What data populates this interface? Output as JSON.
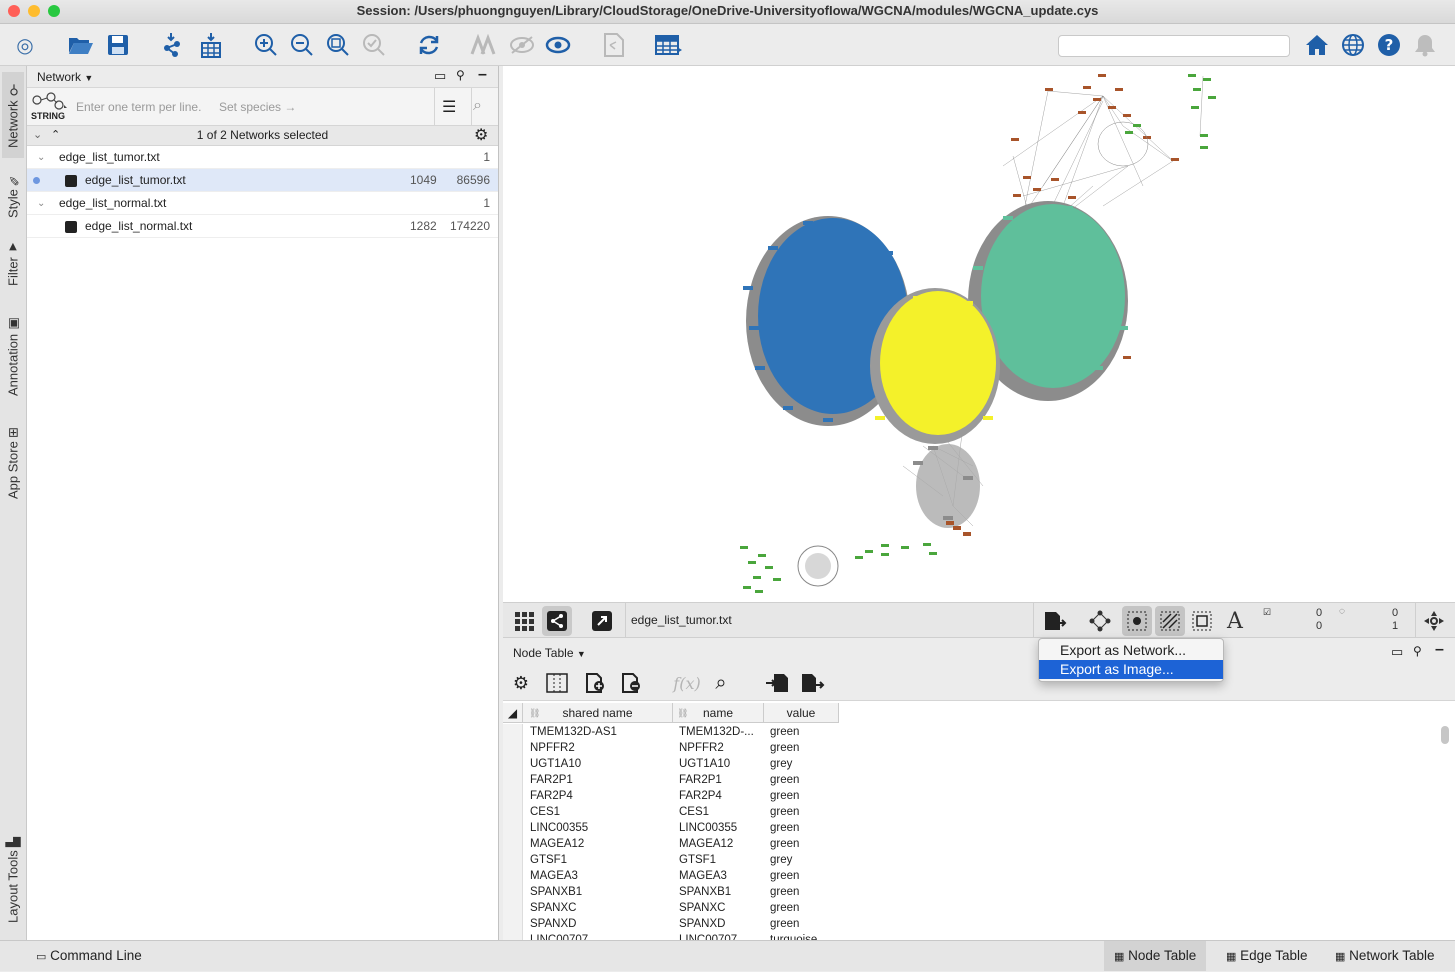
{
  "window": {
    "title": "Session: /Users/phuongnguyen/Library/CloudStorage/OneDrive-UniversityofIowa/WGCNA/modules/WGCNA_update.cys"
  },
  "toolbar": {
    "search_placeholder": ""
  },
  "side_tabs": [
    "Network",
    "Style",
    "Filter",
    "Annotation",
    "App Store",
    "Layout Tools"
  ],
  "network_panel": {
    "header": "Network",
    "string_query_placeholder": "Enter one term per line.",
    "set_species": "Set species →",
    "string_logo": "STRING",
    "selected_summary": "1 of 2 Networks selected",
    "collections": [
      {
        "name": "edge_list_tumor.txt",
        "count": "1",
        "networks": [
          {
            "name": "edge_list_tumor.txt",
            "nodes": "1049",
            "edges": "86596"
          }
        ]
      },
      {
        "name": "edge_list_normal.txt",
        "count": "1",
        "networks": [
          {
            "name": "edge_list_normal.txt",
            "nodes": "1282",
            "edges": "174220"
          }
        ]
      }
    ]
  },
  "network_view_bar": {
    "network_name": "edge_list_tumor.txt",
    "sel_nodes": "0",
    "sel_edges": "0",
    "hidden_nodes": "0",
    "hidden_edges": "1"
  },
  "export_menu": {
    "items": [
      "Export as Network...",
      "Export as Image..."
    ],
    "highlighted_index": 1
  },
  "node_table": {
    "title": "Node Table",
    "fx": "f(x)",
    "columns": [
      "shared name",
      "name",
      "value"
    ],
    "rows": [
      [
        "TMEM132D-AS1",
        "TMEM132D-...",
        "green"
      ],
      [
        "NPFFR2",
        "NPFFR2",
        "green"
      ],
      [
        "UGT1A10",
        "UGT1A10",
        "grey"
      ],
      [
        "FAR2P1",
        "FAR2P1",
        "green"
      ],
      [
        "FAR2P4",
        "FAR2P4",
        "green"
      ],
      [
        "CES1",
        "CES1",
        "green"
      ],
      [
        "LINC00355",
        "LINC00355",
        "green"
      ],
      [
        "MAGEA12",
        "MAGEA12",
        "green"
      ],
      [
        "GTSF1",
        "GTSF1",
        "grey"
      ],
      [
        "MAGEA3",
        "MAGEA3",
        "green"
      ],
      [
        "SPANXB1",
        "SPANXB1",
        "green"
      ],
      [
        "SPANXC",
        "SPANXC",
        "green"
      ],
      [
        "SPANXD",
        "SPANXD",
        "green"
      ],
      [
        "LINC00707",
        "LINC00707",
        "turquoise"
      ]
    ]
  },
  "status_bar": {
    "command_line": "Command Line",
    "tabs": [
      "Node Table",
      "Edge Table",
      "Network Table"
    ],
    "active_tab": "Node Table"
  },
  "colors": {
    "accent_blue": "#1f5fa8",
    "module_blue": "#2f74b8",
    "module_yellow": "#f4f12a",
    "module_turquoise": "#5fbf9b",
    "module_brown": "#a8542a",
    "module_green": "#4aa63c",
    "module_grey": "#8c8c8c",
    "menu_highlight": "#1d63d6"
  }
}
